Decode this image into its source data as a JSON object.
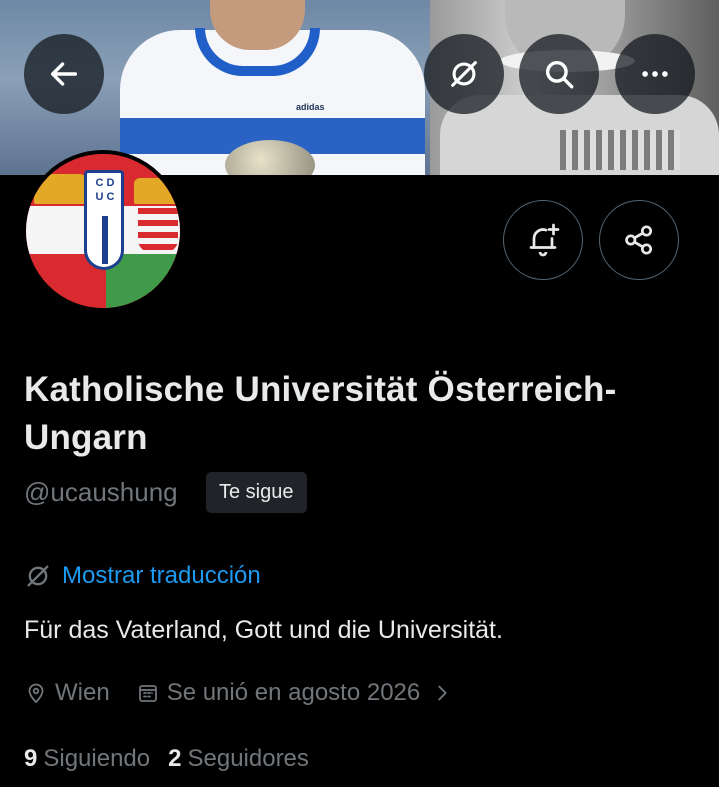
{
  "header": {
    "back_icon": "arrow-left-icon",
    "translate_icon": "no-translate-icon",
    "search_icon": "search-icon",
    "more_icon": "more-horizontal-icon"
  },
  "banner": {
    "jersey_text": "adidas"
  },
  "avatar": {
    "shield_text_top": "C D",
    "shield_text_bottom": "U C"
  },
  "profile": {
    "display_name": "Katholische Universität Österreich-Ungarn",
    "handle": "@ucaushung",
    "follows_you_badge": "Te sigue",
    "show_translation_label": "Mostrar traducción",
    "bio": "Für das Vaterland, Gott und die Universität.",
    "location": "Wien",
    "joined": "Se unió en agosto 2026",
    "following_count": "9",
    "following_label": "Siguiendo",
    "followers_count": "2",
    "followers_label": "Seguidores"
  },
  "actions": {
    "notify_icon": "bell-plus-icon",
    "share_icon": "share-icon"
  },
  "colors": {
    "background": "#000000",
    "primary_text": "#e7e9ea",
    "secondary_text": "#71767b",
    "link": "#1d9bf0",
    "badge_bg": "#202327"
  }
}
